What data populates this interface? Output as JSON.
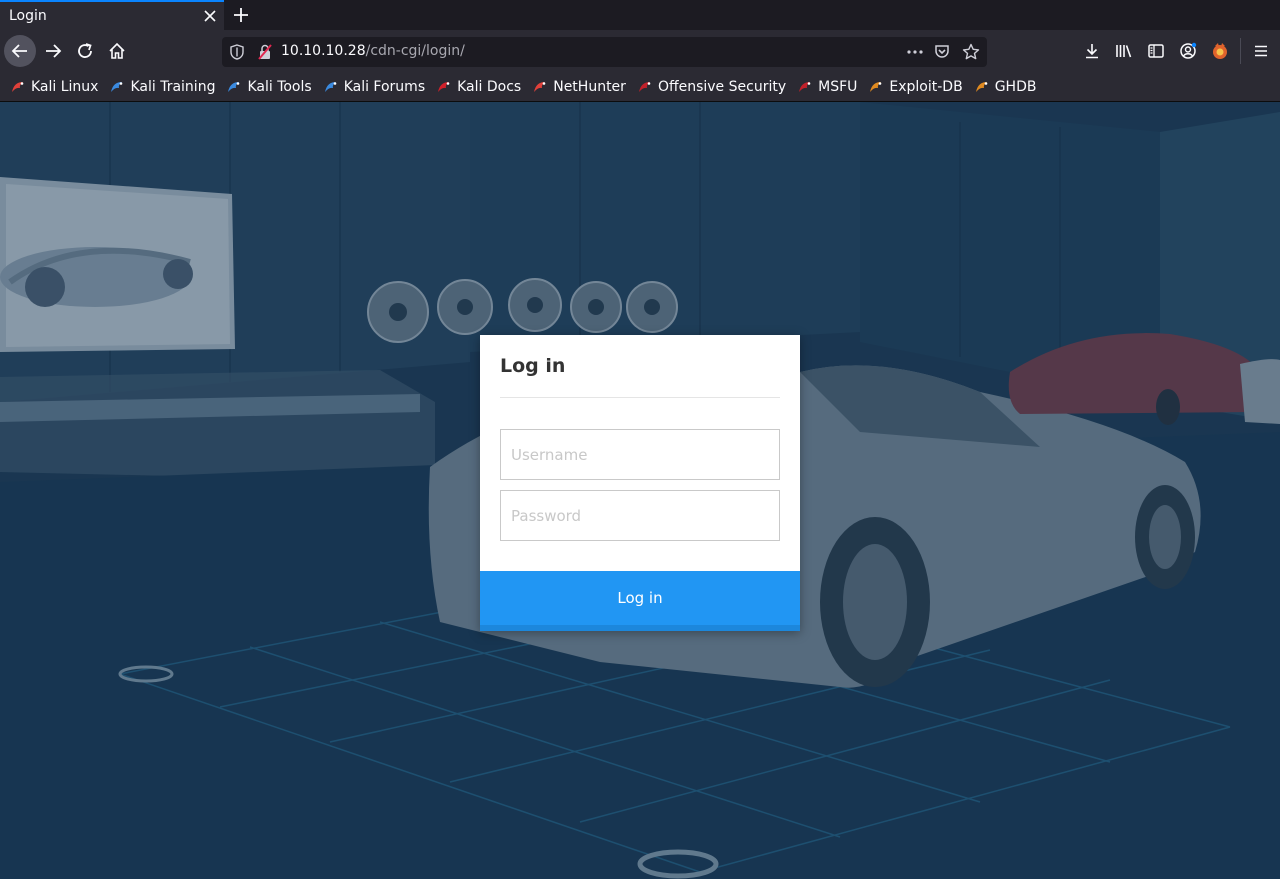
{
  "browser": {
    "tab_title": "Login",
    "url_host": "10.10.10.28",
    "url_path": "/cdn-cgi/login/",
    "accent": "#0a84ff",
    "bookmarks": [
      {
        "label": "Kali Linux",
        "icon": "kali-dragon-icon",
        "color": "#e0403a"
      },
      {
        "label": "Kali Training",
        "icon": "kali-training-icon",
        "color": "#3a8ae0"
      },
      {
        "label": "Kali Tools",
        "icon": "kali-tools-icon",
        "color": "#3a8ae0"
      },
      {
        "label": "Kali Forums",
        "icon": "kali-forums-icon",
        "color": "#3a8ae0"
      },
      {
        "label": "Kali Docs",
        "icon": "kali-docs-icon",
        "color": "#d0202a"
      },
      {
        "label": "NetHunter",
        "icon": "nethunter-icon",
        "color": "#e0403a"
      },
      {
        "label": "Offensive Security",
        "icon": "offsec-icon",
        "color": "#c0202a"
      },
      {
        "label": "MSFU",
        "icon": "msfu-icon",
        "color": "#c0202a"
      },
      {
        "label": "Exploit-DB",
        "icon": "exploitdb-spider-icon",
        "color": "#e08a20"
      },
      {
        "label": "GHDB",
        "icon": "ghdb-spider-icon",
        "color": "#e08a20"
      }
    ]
  },
  "login": {
    "title": "Log in",
    "username_placeholder": "Username",
    "password_placeholder": "Password",
    "submit_label": "Log in",
    "button_color": "#2196f3"
  }
}
